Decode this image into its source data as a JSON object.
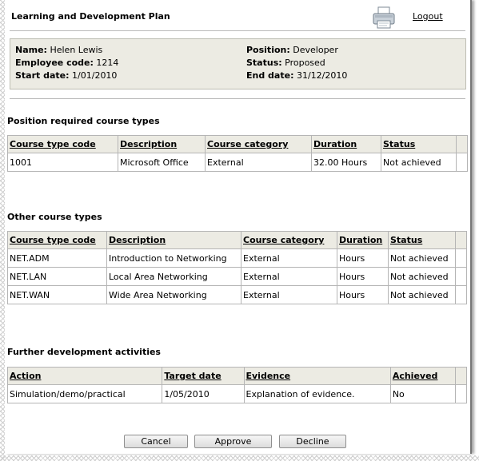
{
  "header": {
    "title": "Learning and Development Plan",
    "logout_label": "Logout"
  },
  "employee": {
    "name_label": "Name:",
    "name": "Helen Lewis",
    "code_label": "Employee code:",
    "code": "1214",
    "start_label": "Start date:",
    "start": "1/01/2010",
    "position_label": "Position:",
    "position": "Developer",
    "status_label": "Status:",
    "status": "Proposed",
    "end_label": "End date:",
    "end": "31/12/2010"
  },
  "required": {
    "title": "Position required course types",
    "columns": [
      "Course type code",
      "Description",
      "Course category",
      "Duration",
      "Status"
    ],
    "rows": [
      [
        "1001",
        "Microsoft Office",
        "External",
        "32.00 Hours",
        "Not achieved"
      ]
    ]
  },
  "other": {
    "title": "Other course types",
    "columns": [
      "Course type code",
      "Description",
      "Course category",
      "Duration",
      "Status"
    ],
    "rows": [
      [
        "NET.ADM",
        "Introduction to Networking",
        "External",
        "Hours",
        "Not achieved"
      ],
      [
        "NET.LAN",
        "Local Area Networking",
        "External",
        "Hours",
        "Not achieved"
      ],
      [
        "NET.WAN",
        "Wide Area Networking",
        "External",
        "Hours",
        "Not achieved"
      ]
    ]
  },
  "further": {
    "title": "Further development activities",
    "columns": [
      "Action",
      "Target date",
      "Evidence",
      "Achieved"
    ],
    "rows": [
      [
        "Simulation/demo/practical",
        "1/05/2010",
        "Explanation of evidence.",
        "No"
      ]
    ]
  },
  "buttons": {
    "cancel": "Cancel",
    "approve": "Approve",
    "decline": "Decline"
  },
  "icons": {
    "printer": "printer-icon"
  }
}
